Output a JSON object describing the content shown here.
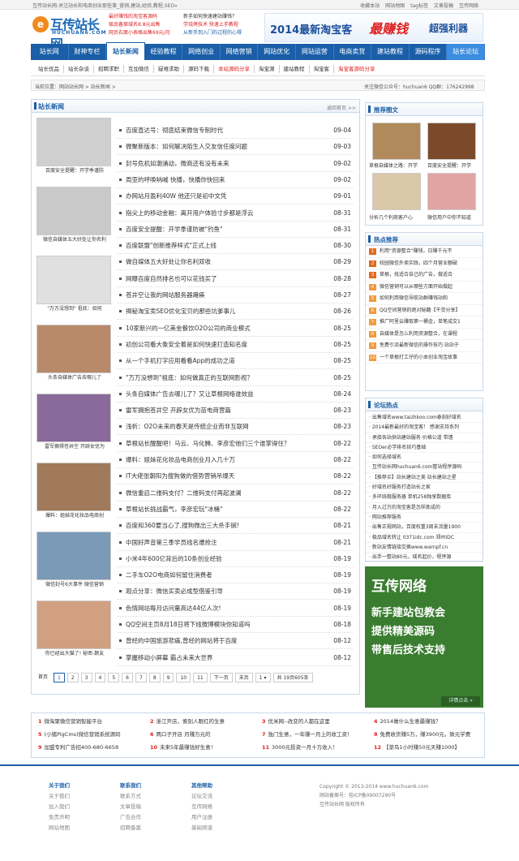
{
  "topbar": {
    "title": "互传站长网-关注站长和电商创业那些事_营销,建站,经验,教程,SEO»",
    "links": [
      "收藏本站",
      "网站地图",
      "tag标签",
      "文章投稿",
      "互传网络"
    ]
  },
  "logo": {
    "name": "互传站长网",
    "domain": "HUCHUAN6.COM",
    "mark": "e"
  },
  "header_links": {
    "col1": [
      "最好赚钱的淘宝客源码",
      "极品备案域名8.8元出售",
      "网页右面小表格出售69元/月"
    ],
    "col2": [
      "新手如何快速建站赚钱？",
      "学烧烤技术 快速上手教程",
      "从新手到入门的过程的心得"
    ]
  },
  "banner": {
    "part1": "2014最新淘宝客",
    "part2": "最赚钱",
    "part3": "超强利器"
  },
  "nav": [
    "站长网",
    "财神专栏",
    "站长新闻",
    "经验教程",
    "网络创业",
    "网络营销",
    "网站优化",
    "网站运营",
    "电商卖货",
    "建站教程",
    "源码程序",
    "站长论坛"
  ],
  "subnav": [
    "站长优品",
    "站长杂谈",
    "招聘求职",
    "互加微信",
    "疑难求助",
    "源码下载",
    "本站源码分享",
    "淘宝源",
    "建站教程",
    "淘宝客",
    "淘宝客源码分享"
  ],
  "breadcrumb": {
    "left": "当前位置：网站站长网 > 站长新闻 >",
    "right": "关注微信公众号：huchuan6 QQ群：176242998"
  },
  "main": {
    "title": "站长新闻",
    "more": "返回首页 >>",
    "thumb_captions": [
      "百度安全提醒：开学季谨防",
      "微信自媒体五大好处让你名利",
      "\"万万没想到\" 祖底：如何",
      "头条自媒体广告去哪儿了",
      "雷军摘得苍井空 开辟女优为",
      "爆料：姐姊花化妆品电商创",
      "微信封号6大事件 微信营销",
      "你已经出大猫了! 秘密-颠友"
    ],
    "news": [
      {
        "title": "百度直达号：彻底结束微信专制时代",
        "date": "09-04"
      },
      {
        "title": "微聚新版本：如何解决陌生人交友信任度问题",
        "date": "09-03"
      },
      {
        "title": "封号危机如潮涌动，微商还有没有未来",
        "date": "09-02"
      },
      {
        "title": "周亚的呼唤呐喊 快播，快播你快回来",
        "date": "09-02"
      },
      {
        "title": "办网站月盈利40W 他还只是初中文凭",
        "date": "09-01"
      },
      {
        "title": "指尖上的移动金融：离开用户体验寸步都是浮云",
        "date": "08-31"
      },
      {
        "title": "百度安全提醒：开学季谨防被\"钓鱼\"",
        "date": "08-31"
      },
      {
        "title": "百度联盟\"创新推荐样式\"正式上线",
        "date": "08-30"
      },
      {
        "title": "做自媒体五大好处让你名利双收",
        "date": "08-29"
      },
      {
        "title": "网曝百度自然排名也可以花钱买了",
        "date": "08-28"
      },
      {
        "title": "苍井空让我的网站服务器瘫痪",
        "date": "08-27"
      },
      {
        "title": "揭秘淘宝卖SEO优化宝贝的那些坑爹事儿",
        "date": "08-26"
      },
      {
        "title": "10家新兴的一亿美金餐饮O2O公司的商业模式",
        "date": "08-25"
      },
      {
        "title": "初创公司看大象安全着是如何快速打造知名度",
        "date": "08-25"
      },
      {
        "title": "从一个手机打字应用看看App的成功之道",
        "date": "08-25"
      },
      {
        "title": "\"万万没想到\"祖底：如何做真正的互联网影视？",
        "date": "08-25"
      },
      {
        "title": "头条自媒体广告去哪儿了？又让草根网络谁效益",
        "date": "08-24"
      },
      {
        "title": "雷军拥抱苍井空 开辟女优为苗电商营篇",
        "date": "08-23"
      },
      {
        "title": "浅析：O2O未来的春天是传统企业而非互联网",
        "date": "08-23"
      },
      {
        "title": "草根站长醒醒吧！马云、马化腾、李彦宏他们三个谁掌得住？",
        "date": "08-22"
      },
      {
        "title": "爆料：姐妹花化妆品电商创业月入几十万",
        "date": "08-22"
      },
      {
        "title": "IT大佬张朝阳为搜狗做的借势营销吊爆天",
        "date": "08-22"
      },
      {
        "title": "微信重启二维码支付？二维码支付再起波澜",
        "date": "08-22"
      },
      {
        "title": "草根站长挑战霸气，李彦宏玩\"冰桶\"",
        "date": "08-22"
      },
      {
        "title": "百度和360要当心了,搜狗微出三大杀手锏!",
        "date": "08-21"
      },
      {
        "title": "中国好声音第三季学员线名遭抢注",
        "date": "08-21"
      },
      {
        "title": "小米4年600亿背后的10条创业经验",
        "date": "08-19"
      },
      {
        "title": "二手车O2O电商如何留住消费者",
        "date": "08-19"
      },
      {
        "title": "观点分享：微信买卖必成型借鉴引导",
        "date": "08-19"
      },
      {
        "title": "色情网站每月访问量高达44亿人次!",
        "date": "08-19"
      },
      {
        "title": "QQ空间主页8月18日将下线微博模块你知道吗",
        "date": "08-18"
      },
      {
        "title": "曾经的中国旅游悲痛,曾经的网站将于百度",
        "date": "08-12"
      },
      {
        "title": "掌握移动小屏幕 霸占未来大世界",
        "date": "08-12"
      }
    ],
    "pager": {
      "first": "首页",
      "pages": [
        "1",
        "2",
        "3",
        "4",
        "5",
        "6",
        "7",
        "8",
        "9",
        "10",
        "11"
      ],
      "prev": "下一页",
      "last": "末页",
      "select": "1",
      "total": "共 19页605条"
    }
  },
  "side": {
    "recommend": {
      "title": "推荐图文",
      "captions": [
        "草根自媒体之路：开学",
        "百度安全提醒：开学",
        "分析几个利商客户心",
        "微信用户中你不知道"
      ]
    },
    "hot": {
      "title": "热点推荐",
      "items": [
        "利用\"资源整合\"赚钱，日赚千元不",
        "校园微信外卖实践，四个月营业额破",
        "草根，找适合自己的广告，做适合",
        "微信营销可以从哪些方面开始做起",
        "如何利用微信导航站群赚钱站和",
        "QQ空间营销的绝对秘籍【干货分享】",
        "推广阿里云赚取第一桶金，单笔成交1",
        "自媒体是怎么利用资源整合，在课程",
        "免费引流最新微信的操作技巧 站站于",
        "一个草根打工仔的小本创业淘宝故事"
      ]
    },
    "forum": {
      "title": "论坛热点",
      "items": [
        "出售域名www.taizhkoo.com泰刻好域名",
        "2014最新最好的淘宝客！ 感谢支持系列",
        "承接各站供站建站服务 价格公道 带遗",
        "SEOer必学排名技巧基础",
        "如何选择域名",
        "互传站长网huchuan6.com整站程序源码",
        "【推荐买】站长建站之美 站长建站之星",
        "好域名好服务打造站长之家",
        "多环线稳服务器 单机258独享数据库",
        "月入过万的淘宝客是怎样炼成的",
        "网站推荐服务",
        "出售正规网站，百度权重3周末流量1900",
        "极品域名转让 0371idc.com 郑州IDC",
        "新站友情链接交换www.warnpf.cn",
        "出手一整站80元，域名起价，程序源"
      ]
    },
    "ad": {
      "t1": "互传网络",
      "t2a": "新手建站包教会",
      "t2b": "提供精美源码",
      "t2c": "带售后技术支持",
      "btn": "详情点击 »"
    }
  },
  "bottom_list": [
    {
      "n": "1",
      "t": "微淘聚微信营销智能平台"
    },
    {
      "n": "2",
      "t": "浙江开店，索别人眼红的生意"
    },
    {
      "n": "3",
      "t": "优米网--改变的人都在这里"
    },
    {
      "n": "4",
      "t": "2014做什么生意最赚钱？"
    },
    {
      "n": "5",
      "t": "(小猪PigCms)微信营销系统源码"
    },
    {
      "n": "6",
      "t": "两口子开店 月赚万元的"
    },
    {
      "n": "7",
      "t": "独门生意，一年赚一月上的收工资！"
    },
    {
      "n": "8",
      "t": "免费收货赚5万，赚3900元，致元学费"
    },
    {
      "n": "9",
      "t": "加盟专利广告招400-680-6658"
    },
    {
      "n": "10",
      "t": "未来5年最赚钱好生意！"
    },
    {
      "n": "11",
      "t": "3000元投资一月十万收入！"
    },
    {
      "n": "12",
      "t": "【菜鸟1小时赚50元天赚1000】"
    }
  ],
  "footer": {
    "cols": [
      {
        "h": "关于我们",
        "items": [
          "关于我们",
          "加入我们",
          "免责声明",
          "网站地图"
        ]
      },
      {
        "h": "联系我们",
        "items": [
          "联系方式",
          "文章投稿",
          "广告合作",
          "招聘备案"
        ]
      },
      {
        "h": "其他帮助",
        "items": [
          "论坛交流",
          "互传网络",
          "用户注册",
          "基础频道"
        ]
      }
    ],
    "copyright": "Copyright © 2013-2014 www.huchuan6.com",
    "icp": "网站备案号：桂ICP备09007290号",
    "rights": "互传站长网 版权所有"
  },
  "colors": {
    "brand": "#1a5fa8",
    "accent": "#e02020",
    "ad_green": "#3a7d30"
  }
}
